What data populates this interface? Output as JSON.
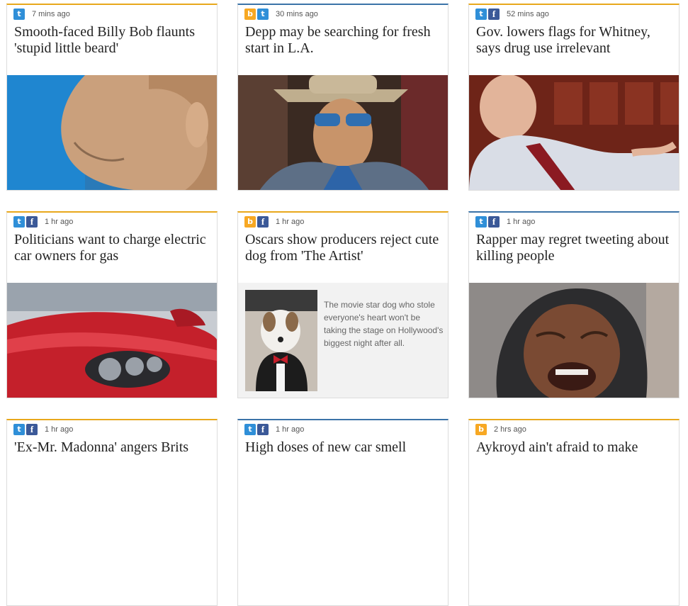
{
  "cards": [
    {
      "time": "7 mins ago",
      "headline": "Smooth-faced Billy Bob flaunts 'stupid little beard'"
    },
    {
      "time": "30 mins ago",
      "headline": "Depp may be searching for fresh start in L.A."
    },
    {
      "time": "52 mins ago",
      "headline": "Gov. lowers flags for Whitney, says drug use irrelevant"
    },
    {
      "time": "1 hr ago",
      "headline": "Politicians want to charge electric car owners for gas"
    },
    {
      "time": "1 hr ago",
      "headline": "Oscars show producers reject cute dog from 'The Artist'",
      "teaser": "The movie star dog who stole everyone's heart won't be taking the stage on Hollywood's biggest night after all."
    },
    {
      "time": "1 hr ago",
      "headline": "Rapper may regret tweeting about killing people"
    },
    {
      "time": "1 hr ago",
      "headline": "'Ex-Mr. Madonna' angers Brits"
    },
    {
      "time": "1 hr ago",
      "headline": "High doses of new car smell"
    },
    {
      "time": "2 hrs ago",
      "headline": "Aykroyd ain't afraid to make"
    }
  ],
  "icons": {
    "twitter": "twitter-icon",
    "facebook": "facebook-icon",
    "bing": "bing-icon"
  },
  "colors": {
    "gold": "#e8a81c",
    "blue": "#3b73a8",
    "twitter": "#2f8fd8",
    "facebook": "#3b5998",
    "bing": "#f7a823"
  }
}
